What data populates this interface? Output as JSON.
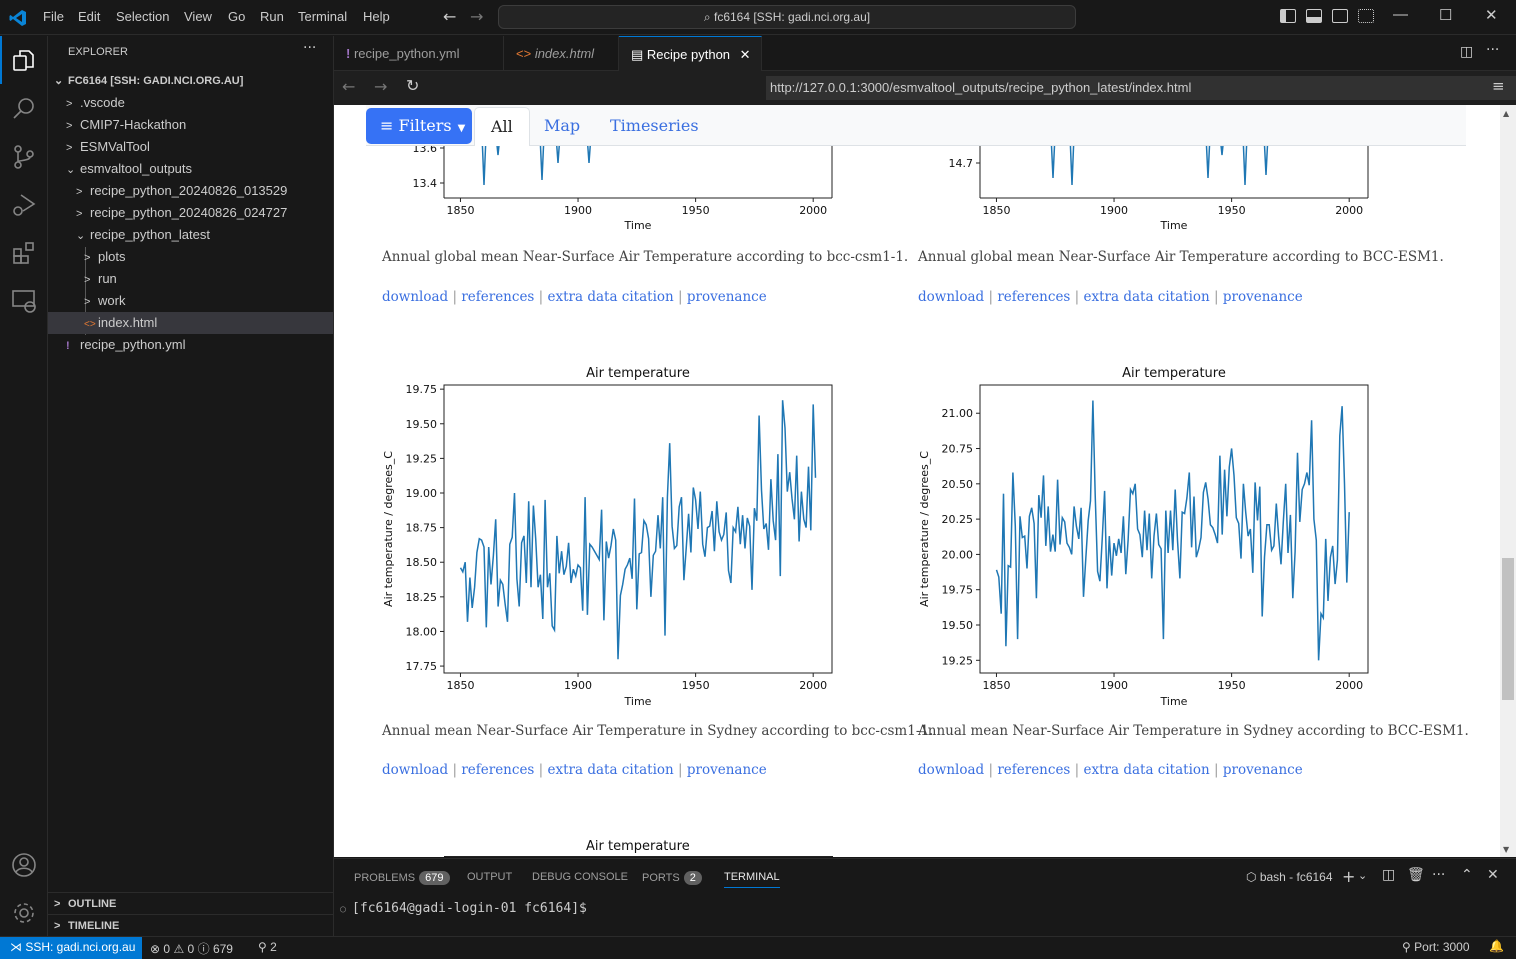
{
  "titlebar": {
    "menu": [
      "File",
      "Edit",
      "Selection",
      "View",
      "Go",
      "Run",
      "Terminal",
      "Help"
    ],
    "command_center": "fc6164 [SSH: gadi.nci.org.au]"
  },
  "sidebar": {
    "title": "EXPLORER",
    "root": "FC6164 [SSH: GADI.NCI.ORG.AU]",
    "items": [
      {
        "label": ".vscode",
        "indent": 1,
        "chev": ">"
      },
      {
        "label": "CMIP7-Hackathon",
        "indent": 1,
        "chev": ">"
      },
      {
        "label": "ESMValTool",
        "indent": 1,
        "chev": ">"
      },
      {
        "label": "esmvaltool_outputs",
        "indent": 1,
        "chev": "v"
      },
      {
        "label": "recipe_python_20240826_013529",
        "indent": 2,
        "chev": ">"
      },
      {
        "label": "recipe_python_20240826_024727",
        "indent": 2,
        "chev": ">"
      },
      {
        "label": "recipe_python_latest",
        "indent": 2,
        "chev": "v"
      },
      {
        "label": "plots",
        "indent": 3,
        "chev": ">"
      },
      {
        "label": "run",
        "indent": 3,
        "chev": ">"
      },
      {
        "label": "work",
        "indent": 3,
        "chev": ">"
      },
      {
        "label": "index.html",
        "indent": 3,
        "chev": "<>"
      },
      {
        "label": "recipe_python.yml",
        "indent": 1,
        "chev": "!"
      }
    ],
    "outline": "OUTLINE",
    "timeline": "TIMELINE"
  },
  "tabs": [
    {
      "label": "recipe_python.yml",
      "icon": "!"
    },
    {
      "label": "index.html",
      "icon": "<>"
    },
    {
      "label": "Recipe python",
      "icon": "preview"
    }
  ],
  "browser": {
    "url": "http://127.0.0.1:3000/esmvaltool_outputs/recipe_python_latest/index.html"
  },
  "page": {
    "filters_label": "Filters",
    "tabs": [
      "All",
      "Map",
      "Timeseries"
    ],
    "links": [
      "download",
      "references",
      "extra data citation",
      "provenance"
    ],
    "captions": [
      "Annual global mean Near-Surface Air Temperature according to bcc-csm1-1.",
      "Annual global mean Near-Surface Air Temperature according to BCC-ESM1.",
      "Annual mean Near-Surface Air Temperature in Sydney according to bcc-csm1-1.",
      "Annual mean Near-Surface Air Temperature in Sydney according to BCC-ESM1."
    ],
    "bottom_plot_title": "Air temperature"
  },
  "chart_data": [
    {
      "type": "line",
      "title": "",
      "xlabel": "Time",
      "ylabel": "",
      "xticks": [
        1850,
        1900,
        1950,
        2000
      ],
      "yticks": [
        "13.4",
        "13.6"
      ],
      "partial": true,
      "note": "global mean bcc-csm1-1 (cropped top)"
    },
    {
      "type": "line",
      "title": "",
      "xlabel": "Time",
      "ylabel": "",
      "xticks": [
        1850,
        1900,
        1950,
        2000
      ],
      "yticks": [
        "14.7"
      ],
      "partial": true,
      "note": "global mean BCC-ESM1 (cropped top)"
    },
    {
      "type": "line",
      "title": "Air temperature",
      "xlabel": "Time",
      "ylabel": "Air temperature / degrees_C",
      "xlim": [
        1843,
        2008
      ],
      "ylim": [
        17.7,
        19.78
      ],
      "xticks": [
        1850,
        1900,
        1950,
        2000
      ],
      "yticks": [
        "17.75",
        "18.00",
        "18.25",
        "18.50",
        "18.75",
        "19.00",
        "19.25",
        "19.50",
        "19.75"
      ],
      "x_start": 1850,
      "values": [
        18.46,
        18.43,
        18.5,
        18.07,
        18.39,
        18.17,
        18.32,
        18.57,
        18.67,
        18.66,
        18.61,
        18.03,
        18.61,
        18.34,
        18.55,
        18.81,
        18.18,
        18.37,
        18.34,
        18.2,
        18.07,
        18.63,
        18.68,
        19.0,
        18.38,
        18.18,
        18.64,
        18.69,
        18.35,
        18.94,
        18.32,
        18.91,
        18.67,
        18.32,
        18.41,
        18.09,
        18.95,
        18.32,
        18.42,
        18.04,
        18.01,
        18.69,
        18.42,
        18.58,
        18.41,
        18.47,
        18.64,
        18.35,
        18.45,
        18.4,
        18.48,
        18.46,
        18.15,
        18.97,
        18.12,
        18.63,
        18.61,
        18.58,
        18.55,
        18.52,
        18.88,
        18.08,
        18.65,
        18.53,
        18.62,
        18.74,
        18.66,
        17.8,
        18.26,
        18.34,
        18.45,
        18.48,
        18.53,
        18.38,
        18.96,
        18.16,
        18.56,
        18.57,
        18.8,
        18.77,
        18.67,
        18.25,
        18.55,
        18.58,
        18.84,
        18.6,
        18.97,
        17.97,
        18.97,
        19.36,
        18.76,
        18.6,
        18.62,
        18.9,
        18.97,
        18.37,
        18.6,
        18.85,
        18.57,
        19.04,
        18.95,
        18.74,
        19.01,
        18.63,
        18.54,
        18.75,
        18.76,
        18.87,
        18.58,
        18.94,
        18.72,
        18.66,
        18.7,
        18.86,
        18.44,
        18.35,
        18.75,
        18.72,
        18.9,
        18.63,
        18.84,
        18.6,
        18.82,
        18.76,
        18.3,
        18.89,
        18.8,
        19.56,
        19.02,
        18.74,
        18.78,
        18.59,
        19.1,
        18.8,
        18.66,
        19.28,
        18.4,
        19.67,
        19.47,
        19.01,
        19.15,
        18.96,
        18.81,
        19.27,
        18.65,
        19.01,
        18.81,
        18.75,
        19.19,
        18.73,
        19.64,
        19.11
      ]
    },
    {
      "type": "line",
      "title": "Air temperature",
      "xlabel": "Time",
      "ylabel": "Air temperature / degrees_C",
      "xlim": [
        1843,
        2008
      ],
      "ylim": [
        19.16,
        21.2
      ],
      "xticks": [
        1850,
        1900,
        1950,
        2000
      ],
      "yticks": [
        "19.25",
        "19.50",
        "19.75",
        "20.00",
        "20.25",
        "20.50",
        "20.75",
        "21.00"
      ],
      "x_start": 1850,
      "values": [
        19.89,
        19.84,
        19.58,
        20.43,
        19.35,
        19.92,
        19.91,
        20.58,
        20.2,
        19.4,
        20.27,
        20.12,
        20.13,
        19.9,
        20.27,
        20.33,
        20.22,
        19.69,
        20.42,
        20.26,
        20.56,
        20.06,
        20.34,
        20.02,
        20.14,
        20.02,
        20.53,
        20.07,
        20.26,
        20.23,
        20.08,
        20.05,
        20.0,
        20.34,
        20.2,
        20.11,
        20.33,
        19.7,
        19.97,
        20.24,
        20.38,
        21.09,
        20.42,
        19.88,
        19.81,
        20.12,
        20.45,
        19.76,
        20.13,
        19.85,
        20.08,
        19.99,
        20.11,
        20.01,
        20.27,
        19.86,
        20.1,
        20.46,
        20.43,
        20.5,
        20.18,
        20.14,
        19.98,
        20.31,
        20.03,
        20.29,
        19.83,
        20.13,
        20.29,
        20.07,
        20.04,
        19.4,
        20.31,
        20.01,
        20.31,
        20.03,
        20.46,
        20.1,
        19.83,
        20.3,
        20.29,
        20.4,
        20.58,
        20.05,
        20.41,
        19.98,
        20.04,
        20.12,
        20.44,
        20.51,
        20.39,
        20.21,
        20.19,
        20.14,
        20.08,
        20.7,
        20.14,
        20.6,
        20.27,
        20.62,
        20.75,
        20.56,
        20.26,
        20.22,
        19.97,
        20.5,
        20.3,
        20.13,
        20.18,
        19.87,
        20.51,
        20.24,
        20.48,
        19.56,
        19.98,
        20.21,
        20.21,
        20.03,
        20.06,
        20.36,
        20.13,
        19.93,
        20.23,
        20.5,
        20.01,
        20.28,
        19.69,
        20.02,
        20.72,
        20.23,
        20.46,
        20.5,
        20.58,
        20.49,
        20.95,
        20.25,
        20.1,
        19.25,
        19.58,
        19.55,
        20.11,
        19.67,
        19.98,
        20.06,
        19.79,
        19.96,
        20.84,
        21.05,
        20.5,
        19.8,
        20.3
      ]
    }
  ],
  "panel": {
    "tabs": [
      {
        "label": "PROBLEMS",
        "badge": "679"
      },
      {
        "label": "OUTPUT"
      },
      {
        "label": "DEBUG CONSOLE"
      },
      {
        "label": "PORTS",
        "badge": "2"
      },
      {
        "label": "TERMINAL"
      }
    ],
    "terminal_name": "bash - fc6164",
    "prompt": "[fc6164@gadi-login-01 fc6164]$"
  },
  "statusbar": {
    "remote": "SSH: gadi.nci.org.au",
    "errors": "0",
    "warnings": "0",
    "info": "679",
    "ports": "2",
    "port_label": "Port: 3000"
  }
}
